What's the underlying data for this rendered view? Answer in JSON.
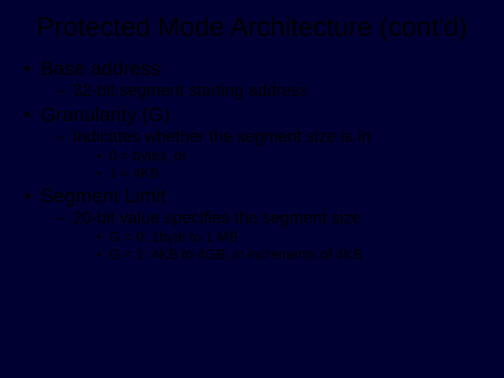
{
  "title": "Protected Mode Architecture (cont'd)",
  "bullets": [
    {
      "text": "Base address",
      "sub": [
        {
          "text": "32-bit segment starting address",
          "sub": []
        }
      ]
    },
    {
      "text": "Granularity (G)",
      "sub": [
        {
          "text": "Indicates whether the segment size is in",
          "sub": [
            {
              "text": "0 = bytes, or"
            },
            {
              "text": "1 = 4KB"
            }
          ]
        }
      ]
    },
    {
      "text": "Segment Limit",
      "sub": [
        {
          "text": "20-bit value specifies the segment size",
          "sub": [
            {
              "text": "G = 0: 1byte to 1 MB"
            },
            {
              "text": "G = 1: 4KB to 4GB, in increments of 4KB"
            }
          ]
        }
      ]
    }
  ]
}
